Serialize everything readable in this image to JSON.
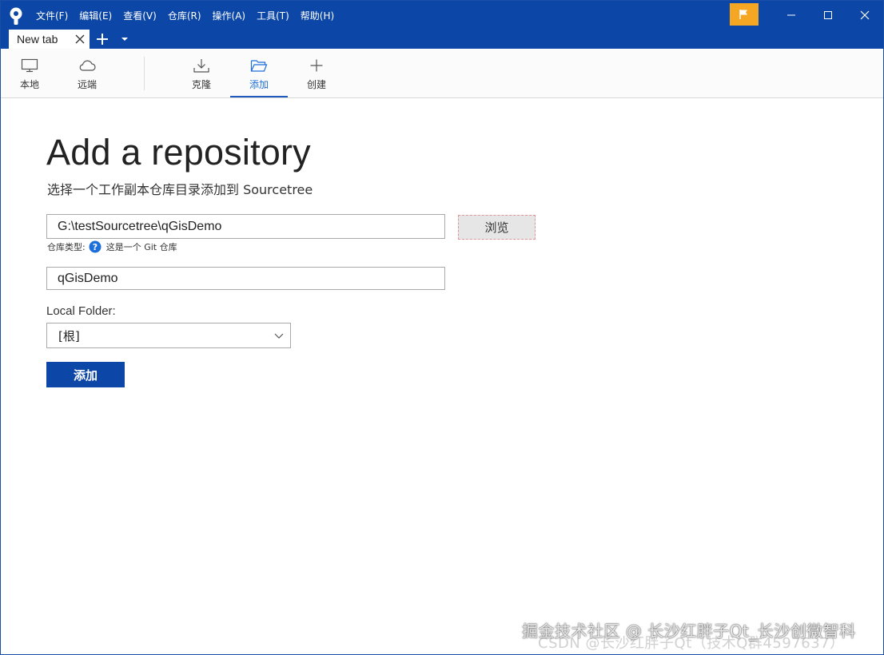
{
  "menu": {
    "items": [
      "文件(F)",
      "编辑(E)",
      "查看(V)",
      "仓库(R)",
      "操作(A)",
      "工具(T)",
      "帮助(H)"
    ]
  },
  "window_controls": {
    "icons": [
      "flag-icon",
      "minimize-icon",
      "maximize-icon",
      "close-icon"
    ],
    "flag_color": "#f5a623"
  },
  "tabs": [
    {
      "title": "New tab"
    }
  ],
  "toolbar": {
    "local_label": "本地",
    "remote_label": "远端",
    "clone_label": "克隆",
    "add_label": "添加",
    "create_label": "创建",
    "active": "添加"
  },
  "form": {
    "title": "Add a repository",
    "subtitle": "选择一个工作副本仓库目录添加到 Sourcetree",
    "path_value": "G:\\testSourcetree\\qGisDemo",
    "browse_label": "浏览",
    "repo_type_label": "仓库类型:",
    "repo_type_value": "这是一个 Git 仓库",
    "name_value": "qGisDemo",
    "local_folder_label": "Local Folder:",
    "local_folder_value": "[根]",
    "submit_label": "添加"
  },
  "colors": {
    "brand": "#0c47a8",
    "accent": "#1e6fd9",
    "help_icon": "#1e6fd9"
  },
  "watermark": {
    "line1": "掘金技术社区 @ 长沙红胖子Qt_长沙创微智科",
    "line2": "CSDN @长沙红胖子Qt（技术Q群4597637）"
  }
}
